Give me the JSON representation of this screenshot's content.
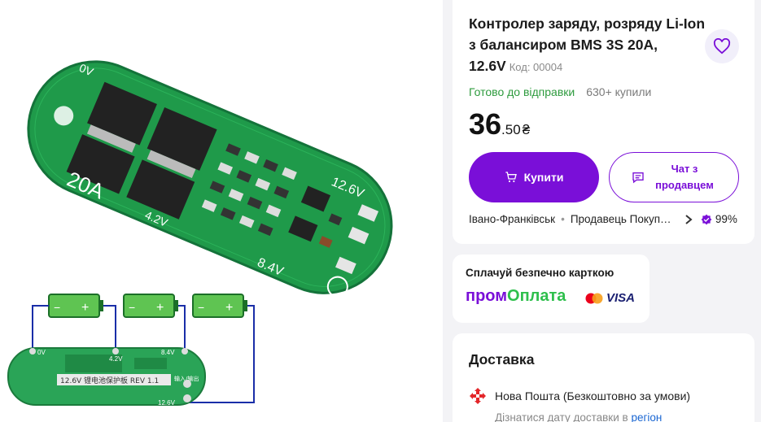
{
  "product": {
    "title": "Контролер заряду, розряду Li-Ion з балансиром BMS 3S 20A, 12.6V",
    "code": "Код: 00004",
    "status": "Готово до відправки",
    "sold": "630+ купили",
    "price_int": "36",
    "price_frac": ".50",
    "currency": "₴"
  },
  "buttons": {
    "buy": "Купити",
    "chat": "Чат з продавцем"
  },
  "seller": {
    "city": "Івано-Франківськ",
    "name": "Продавець Покуп…",
    "rating": "99%"
  },
  "payment": {
    "text": "Сплачуй безпечно карткою",
    "brand_part1": "пром",
    "brand_part2": "Оплата",
    "visa": "VISA"
  },
  "delivery": {
    "title": "Доставка",
    "carrier": "Нова Пошта (Безкоштовно за умови)",
    "date_text": "Дізнатися дату доставки в ",
    "date_link": "регіон"
  },
  "board": {
    "label_20a": "20A",
    "label_0v": "0V",
    "label_42v": "4.2V",
    "label_126v": "12.6V",
    "label_84v": "8.4V",
    "small_0v": "0V",
    "small_42v": "4.2V",
    "small_84v": "8.4V",
    "small_126v": "12.6V",
    "rev": "12.6V 锂电池保护板 REV 1.1",
    "io": "输入/输出",
    "batt_plus": "+",
    "batt_minus": "−"
  },
  "colors": {
    "accent": "#7a0fd8",
    "ready": "#2e9b3e",
    "pcb": "#1f9a4a"
  }
}
